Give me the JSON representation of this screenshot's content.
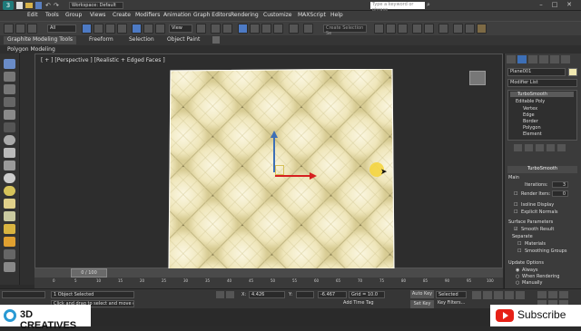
{
  "titlebar": {
    "workspace_label": "Workspace: Default",
    "search_placeholder": "Type a keyword or phrase"
  },
  "menubar": {
    "items": [
      "Edit",
      "Tools",
      "Group",
      "Views",
      "Create",
      "Modifiers",
      "Animation",
      "Graph Editors",
      "Rendering",
      "Customize",
      "MAXScript",
      "Help"
    ]
  },
  "toolbar": {
    "filter_value": "All",
    "view_value": "View",
    "selection_set_placeholder": "Create Selection Se"
  },
  "ribbon": {
    "tabs": [
      "Graphite Modeling Tools",
      "Freeform",
      "Selection",
      "Object Paint"
    ],
    "subtab": "Polygon Modeling"
  },
  "viewport": {
    "label": "[ + ] [Perspective ] [Realistic + Edged Faces ]"
  },
  "rightpanel": {
    "object_name": "Plane001",
    "modifier_list_label": "Modifier List",
    "stack": [
      "TurboSmooth",
      "Editable Poly",
      "Vertex",
      "Edge",
      "Border",
      "Polygon",
      "Element"
    ],
    "rollout_title": "TurboSmooth",
    "main_label": "Main",
    "iterations_label": "Iterations:",
    "iterations_value": "3",
    "render_iters_label": "Render Iters:",
    "render_iters_value": "0",
    "isoline_label": "Isoline Display",
    "explicit_normals_label": "Explicit Normals",
    "surface_params_label": "Surface Parameters",
    "smooth_result_label": "Smooth Result",
    "separate_label": "Separate",
    "materials_label": "Materials",
    "smoothing_groups_label": "Smoothing Groups",
    "update_options_label": "Update Options",
    "always_label": "Always",
    "when_rendering_label": "When Rendering",
    "manually_label": "Manually"
  },
  "timeline": {
    "frame_label": "0 / 100",
    "ticks": [
      "0",
      "5",
      "10",
      "15",
      "20",
      "25",
      "30",
      "35",
      "40",
      "45",
      "50",
      "55",
      "60",
      "65",
      "70",
      "75",
      "80",
      "85",
      "90",
      "95",
      "100"
    ]
  },
  "statusbar": {
    "selected_text": "1 Object Selected",
    "prompt_text": "Click and drag to select and move objects",
    "x_label": "X:",
    "x_value": "4.426",
    "y_label": "Y:",
    "z_value": "-6.467",
    "grid_label": "Grid = 10.0",
    "add_time_tag": "Add Time Tag",
    "auto_key_label": "Auto Key",
    "selected_dropdown": "Selected",
    "set_key_label": "Set Key",
    "key_filters_label": "Key Filters..."
  },
  "overlay": {
    "brand_label": "3D CREATIVES",
    "subscribe_label": "Subscribe"
  },
  "colors": {
    "mesh_fill": "#f2ecc8",
    "mesh_wire": "#cfc69a",
    "accent_blue": "#3d6fb6",
    "subscribe_red": "#e62117"
  }
}
